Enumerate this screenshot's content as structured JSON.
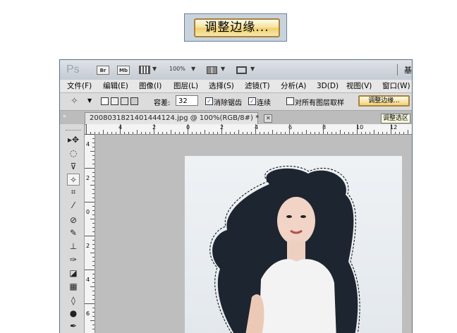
{
  "zoom_button": {
    "label": "调整边缘..."
  },
  "appbar": {
    "logo": "Ps",
    "br": "Br",
    "mb": "Mb",
    "zoom": "100%",
    "right_char": "基"
  },
  "menu": [
    "文件(F)",
    "编辑(E)",
    "图像(I)",
    "图层(L)",
    "选择(S)",
    "滤镜(T)",
    "分析(A)",
    "3D(D)",
    "视图(V)",
    "窗口(W)"
  ],
  "options": {
    "tolerance_label": "容差:",
    "tolerance_value": "32",
    "anti_alias": "消除锯齿",
    "contiguous": "连续",
    "sample_all": "对所有图层取样",
    "refine_button": "调整边缘...",
    "tooltip": "调整选区"
  },
  "document": {
    "tab_title": "2008031821401444124.jpg @ 100%(RGB/8#) *",
    "close": "✕"
  },
  "ruler_h": [
    "4",
    "2",
    "0",
    "2",
    "4",
    "6",
    "8",
    "10",
    "12"
  ],
  "ruler_v": [
    "4",
    "2",
    "0",
    "2",
    "4",
    "6"
  ],
  "colors": {
    "accent": "#f5df98",
    "frame": "#5b6f87"
  }
}
